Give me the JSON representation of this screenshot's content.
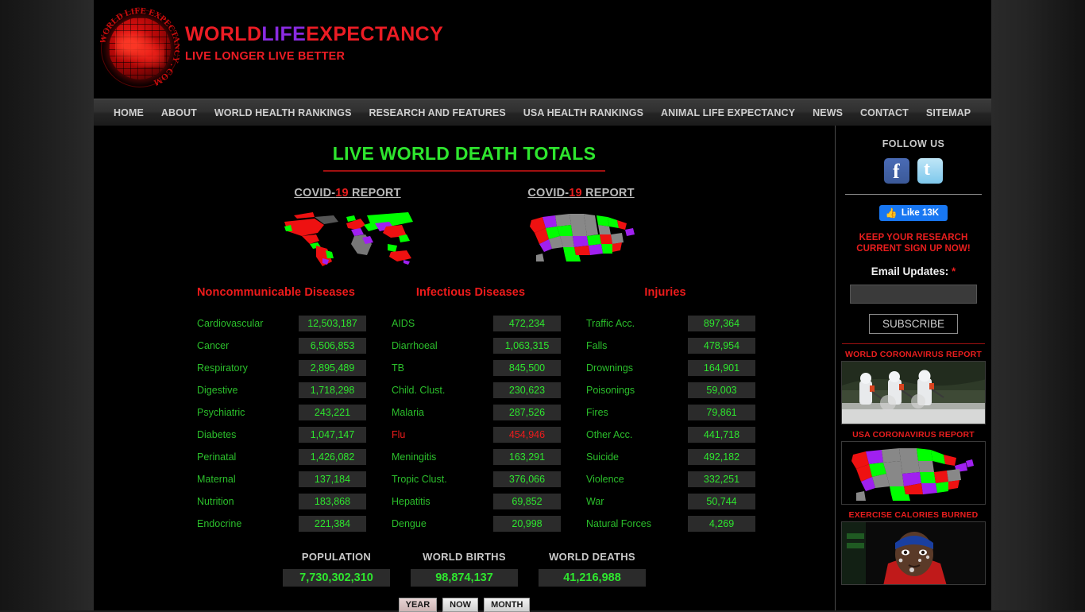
{
  "brand": {
    "part1": "WORLD",
    "part2": "LIFE",
    "part3": "EXPECTANCY",
    "tagline": "LIVE LONGER LIVE BETTER",
    "logo_alt": "world-life-expectancy-com-globe-logo"
  },
  "nav": {
    "items": [
      "HOME",
      "ABOUT",
      "WORLD HEALTH RANKINGS",
      "RESEARCH AND FEATURES",
      "USA HEALTH RANKINGS",
      "ANIMAL LIFE EXPECTANCY",
      "NEWS",
      "CONTACT",
      "SITEMAP"
    ]
  },
  "main": {
    "title": "LIVE WORLD DEATH TOTALS",
    "covid_world": {
      "prefix": "COVID-",
      "highlight": "19",
      "suffix": " REPORT"
    },
    "covid_usa": {
      "prefix": "COVID-",
      "highlight": "19",
      "suffix": " REPORT"
    },
    "columns": [
      {
        "heading": "Noncommunicable Diseases",
        "rows": [
          {
            "label": "Cardiovascular",
            "value": "12,503,187",
            "alert": false
          },
          {
            "label": "Cancer",
            "value": "6,506,853",
            "alert": false
          },
          {
            "label": "Respiratory",
            "value": "2,895,489",
            "alert": false
          },
          {
            "label": "Digestive",
            "value": "1,718,298",
            "alert": false
          },
          {
            "label": "Psychiatric",
            "value": "243,221",
            "alert": false
          },
          {
            "label": "Diabetes",
            "value": "1,047,147",
            "alert": false
          },
          {
            "label": "Perinatal",
            "value": "1,426,082",
            "alert": false
          },
          {
            "label": "Maternal",
            "value": "137,184",
            "alert": false
          },
          {
            "label": "Nutrition",
            "value": "183,868",
            "alert": false
          },
          {
            "label": "Endocrine",
            "value": "221,384",
            "alert": false
          }
        ]
      },
      {
        "heading": "Infectious Diseases",
        "rows": [
          {
            "label": "AIDS",
            "value": "472,234",
            "alert": false
          },
          {
            "label": "Diarrhoeal",
            "value": "1,063,315",
            "alert": false
          },
          {
            "label": "TB",
            "value": "845,500",
            "alert": false
          },
          {
            "label": "Child. Clust.",
            "value": "230,623",
            "alert": false
          },
          {
            "label": "Malaria",
            "value": "287,526",
            "alert": false
          },
          {
            "label": "Flu",
            "value": "454,946",
            "alert": true
          },
          {
            "label": "Meningitis",
            "value": "163,291",
            "alert": false
          },
          {
            "label": "Tropic Clust.",
            "value": "376,066",
            "alert": false
          },
          {
            "label": "Hepatitis",
            "value": "69,852",
            "alert": false
          },
          {
            "label": "Dengue",
            "value": "20,998",
            "alert": false
          }
        ]
      },
      {
        "heading": "Injuries",
        "rows": [
          {
            "label": "Traffic Acc.",
            "value": "897,364",
            "alert": false
          },
          {
            "label": "Falls",
            "value": "478,954",
            "alert": false
          },
          {
            "label": "Drownings",
            "value": "164,901",
            "alert": false
          },
          {
            "label": "Poisonings",
            "value": "59,003",
            "alert": false
          },
          {
            "label": "Fires",
            "value": "79,861",
            "alert": false
          },
          {
            "label": "Other Acc.",
            "value": "441,718",
            "alert": false
          },
          {
            "label": "Suicide",
            "value": "492,182",
            "alert": false
          },
          {
            "label": "Violence",
            "value": "332,251",
            "alert": false
          },
          {
            "label": "War",
            "value": "50,744",
            "alert": false
          },
          {
            "label": "Natural Forces",
            "value": "4,269",
            "alert": false
          }
        ]
      }
    ],
    "totals": [
      {
        "label": "POPULATION",
        "value": "7,730,302,310"
      },
      {
        "label": "WORLD BIRTHS",
        "value": "98,874,137"
      },
      {
        "label": "WORLD DEATHS",
        "value": "41,216,988"
      }
    ],
    "period_buttons": [
      {
        "label": "YEAR",
        "selected": true
      },
      {
        "label": "NOW",
        "selected": false
      },
      {
        "label": "MONTH",
        "selected": false
      }
    ]
  },
  "sidebar": {
    "follow_us": "FOLLOW US",
    "facebook_icon": "facebook-icon",
    "twitter_icon": "twitter-icon",
    "like_label": "Like 13K",
    "keep_line1": "KEEP YOUR RESEARCH",
    "keep_line2": "CURRENT SIGN UP NOW!",
    "email_label": "Email Updates:",
    "email_required": "*",
    "email_value": "",
    "email_placeholder": "",
    "subscribe_label": "SUBSCRIBE",
    "cards": [
      {
        "title": "WORLD CORONAVIRUS REPORT",
        "image": "disinfection-crew-photo"
      },
      {
        "title": "USA CORONAVIRUS REPORT",
        "image": "usa-states-map"
      },
      {
        "title": "EXERCISE CALORIES BURNED",
        "image": "athlete-photo"
      }
    ]
  },
  "colors": {
    "green": "#2ee62e",
    "red": "#ee1b1b",
    "brand_red": "#ec1c24",
    "brand_purple": "#8a2be2",
    "facebook_blue": "#1877f2",
    "panel": "#2b2b2b"
  }
}
